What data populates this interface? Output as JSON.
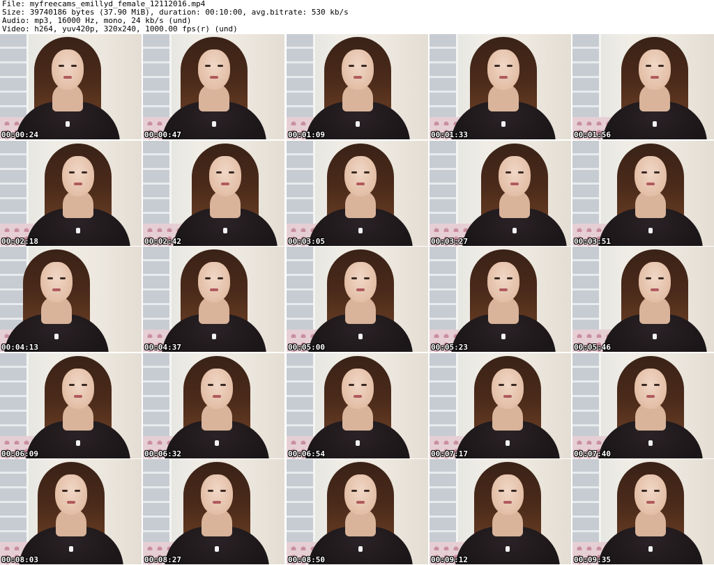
{
  "header": {
    "line1": "File: myfreecams_emillyd_female_12112016.mp4",
    "line2": "Size: 39740186 bytes (37.90 MiB), duration: 00:10:00, avg.bitrate: 530 kb/s",
    "line3": "Audio: mp3, 16000 Hz, mono, 24 kb/s (und)",
    "line4": "Video: h264, yuv420p, 320x240, 1000.00 fps(r) (und)"
  },
  "thumbnails": [
    {
      "timestamp": "00:00:24",
      "offset": 0.48
    },
    {
      "timestamp": "00:00:47",
      "offset": 0.5
    },
    {
      "timestamp": "00:01:09",
      "offset": 0.5
    },
    {
      "timestamp": "00:01:33",
      "offset": 0.52
    },
    {
      "timestamp": "00:01:56",
      "offset": 0.58
    },
    {
      "timestamp": "00:02:18",
      "offset": 0.55
    },
    {
      "timestamp": "00:02:42",
      "offset": 0.58
    },
    {
      "timestamp": "00:03:05",
      "offset": 0.52
    },
    {
      "timestamp": "00:03:27",
      "offset": 0.6
    },
    {
      "timestamp": "00:03:51",
      "offset": 0.55
    },
    {
      "timestamp": "00:04:13",
      "offset": 0.4
    },
    {
      "timestamp": "00:04:37",
      "offset": 0.5
    },
    {
      "timestamp": "00:05:00",
      "offset": 0.52
    },
    {
      "timestamp": "00:05:23",
      "offset": 0.52
    },
    {
      "timestamp": "00:05:46",
      "offset": 0.58
    },
    {
      "timestamp": "00:06:09",
      "offset": 0.55
    },
    {
      "timestamp": "00:06:32",
      "offset": 0.52
    },
    {
      "timestamp": "00:06:54",
      "offset": 0.5
    },
    {
      "timestamp": "00:07:17",
      "offset": 0.55
    },
    {
      "timestamp": "00:07:40",
      "offset": 0.55
    },
    {
      "timestamp": "00:08:03",
      "offset": 0.5
    },
    {
      "timestamp": "00:08:27",
      "offset": 0.52
    },
    {
      "timestamp": "00:08:50",
      "offset": 0.52
    },
    {
      "timestamp": "00:09:12",
      "offset": 0.55
    },
    {
      "timestamp": "00:09:35",
      "offset": 0.55
    }
  ]
}
